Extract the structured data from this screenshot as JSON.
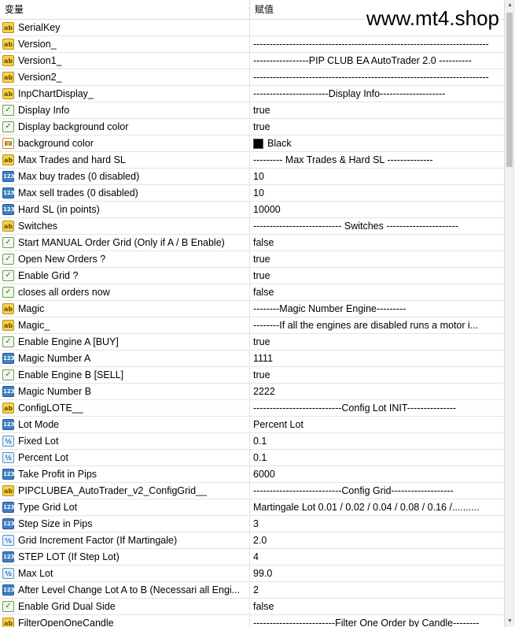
{
  "watermark": "www.mt4.shop",
  "columns": {
    "variable": "变量",
    "value": "赋值"
  },
  "rows": [
    {
      "icon": "ab",
      "name": "SerialKey",
      "value": ""
    },
    {
      "icon": "ab",
      "name": "Version_",
      "value": "------------------------------------------------------------------------"
    },
    {
      "icon": "ab",
      "name": "Version1_",
      "value": "-----------------PIP CLUB EA AutoTrader 2.0 ----------"
    },
    {
      "icon": "ab",
      "name": "Version2_",
      "value": "------------------------------------------------------------------------"
    },
    {
      "icon": "ab",
      "name": "InpChartDisplay_",
      "value": "-----------------------Display Info--------------------"
    },
    {
      "icon": "bool",
      "name": "Display Info",
      "value": "true"
    },
    {
      "icon": "bool",
      "name": "Display background color",
      "value": "true"
    },
    {
      "icon": "color",
      "name": "background color",
      "value": "Black",
      "swatch": "#000000"
    },
    {
      "icon": "ab",
      "name": "Max Trades and hard SL",
      "value": "--------- Max Trades & Hard SL --------------"
    },
    {
      "icon": "n123",
      "name": "Max buy trades (0 disabled)",
      "value": "10"
    },
    {
      "icon": "n123",
      "name": "Max sell trades (0 disabled)",
      "value": "10"
    },
    {
      "icon": "n123",
      "name": "Hard SL (in points)",
      "value": "10000"
    },
    {
      "icon": "ab",
      "name": "Switches",
      "value": "--------------------------- Switches ----------------------"
    },
    {
      "icon": "bool",
      "name": "Start MANUAL Order  Grid  (Only if A / B Enable)",
      "value": "false"
    },
    {
      "icon": "bool",
      "name": "Open New Orders ?",
      "value": "true"
    },
    {
      "icon": "bool",
      "name": "Enable Grid ?",
      "value": "true"
    },
    {
      "icon": "bool",
      "name": "closes all orders now",
      "value": "false"
    },
    {
      "icon": "ab",
      "name": "Magic",
      "value": "--------Magic Number Engine---------"
    },
    {
      "icon": "ab",
      "name": "Magic_",
      "value": "--------If all the engines are disabled runs a motor i..."
    },
    {
      "icon": "bool",
      "name": "Enable Engine A   [BUY]",
      "value": "true"
    },
    {
      "icon": "n123",
      "name": "Magic Number  A",
      "value": "1111"
    },
    {
      "icon": "bool",
      "name": "Enable Engine B   [SELL]",
      "value": "true"
    },
    {
      "icon": "n123",
      "name": "Magic Number  B",
      "value": "2222"
    },
    {
      "icon": "ab",
      "name": "ConfigLOTE__",
      "value": "---------------------------Config Lot INIT---------------"
    },
    {
      "icon": "n123",
      "name": "Lot Mode",
      "value": "Percent Lot"
    },
    {
      "icon": "frac",
      "name": "Fixed Lot",
      "value": "0.1"
    },
    {
      "icon": "frac",
      "name": "Percent Lot",
      "value": "0.1"
    },
    {
      "icon": "n123",
      "name": "Take Profit in Pips",
      "value": "6000"
    },
    {
      "icon": "ab",
      "name": "PIPCLUBEA_AutoTrader_v2_ConfigGrid__",
      "value": "---------------------------Config Grid-------------------"
    },
    {
      "icon": "n123",
      "name": "Type Grid Lot",
      "value": "Martingale Lot  0.01 / 0.02 / 0.04 / 0.08 / 0.16 /.........."
    },
    {
      "icon": "n123",
      "name": "Step Size in Pips",
      "value": "3"
    },
    {
      "icon": "frac",
      "name": "Grid Increment Factor (If Martingale)",
      "value": "2.0"
    },
    {
      "icon": "n123",
      "name": "STEP LOT (If  Step Lot)",
      "value": "4"
    },
    {
      "icon": "frac",
      "name": "Max Lot",
      "value": "99.0"
    },
    {
      "icon": "n123",
      "name": "After Level Change Lot A to B (Necessari all Engi...",
      "value": "2"
    },
    {
      "icon": "bool",
      "name": "Enable Grid Dual Side",
      "value": "false"
    },
    {
      "icon": "ab",
      "name": "FilterOpenOneCandle",
      "value": "-------------------------Filter One Order by Candle--------"
    }
  ]
}
